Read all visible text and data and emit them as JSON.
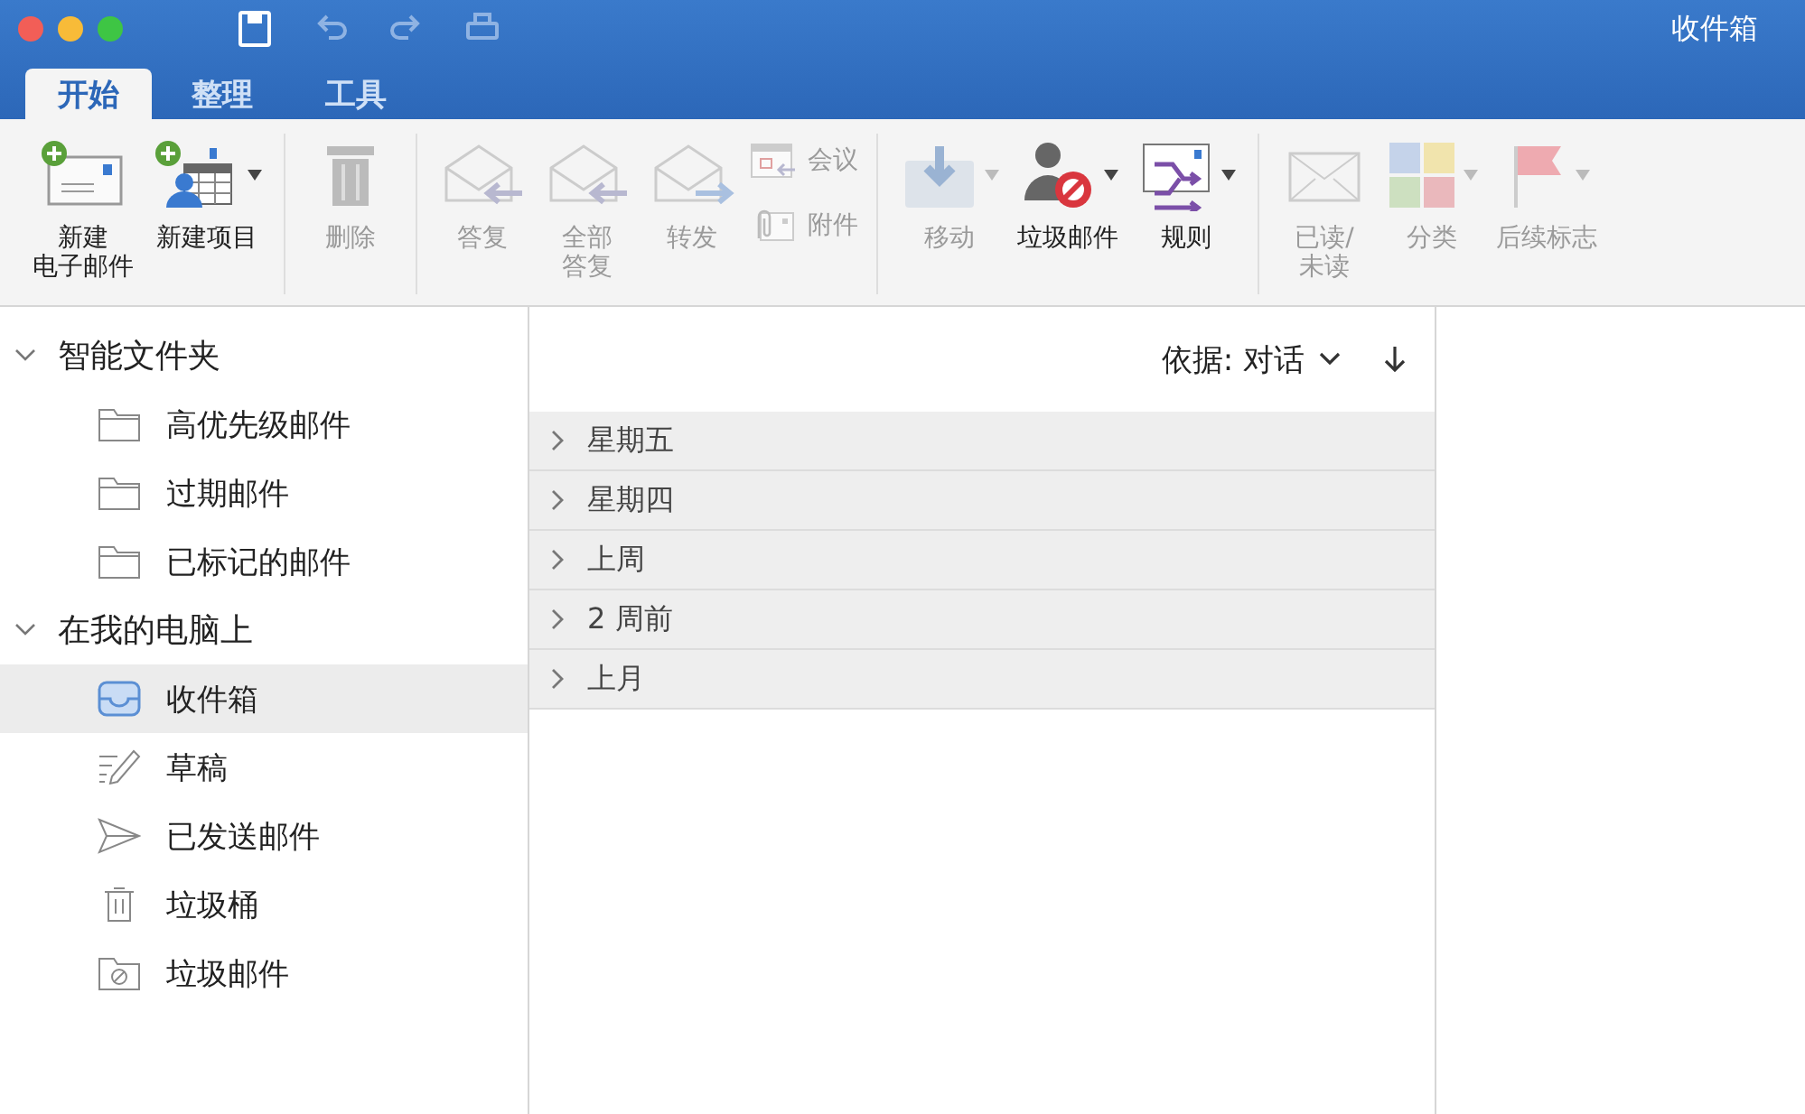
{
  "window": {
    "title": "收件箱"
  },
  "tabs": [
    {
      "label": "开始",
      "selected": true
    },
    {
      "label": "整理",
      "selected": false
    },
    {
      "label": "工具",
      "selected": false
    }
  ],
  "ribbon": [
    {
      "buttons": [
        {
          "kind": "big",
          "label": [
            "新建",
            "电子邮件"
          ],
          "disabled": false,
          "dropdown": false
        },
        {
          "kind": "big",
          "label": "新建项目",
          "disabled": false,
          "dropdown": true
        }
      ]
    },
    {
      "buttons": [
        {
          "kind": "big",
          "label": "删除",
          "disabled": true,
          "dropdown": false
        }
      ]
    },
    {
      "buttons": [
        {
          "kind": "big",
          "label": "答复",
          "disabled": true,
          "dropdown": false
        },
        {
          "kind": "big",
          "label": [
            "全部",
            "答复"
          ],
          "disabled": true,
          "dropdown": false
        },
        {
          "kind": "big",
          "label": "转发",
          "disabled": true,
          "dropdown": false
        },
        {
          "kind": "small",
          "label": "会议",
          "disabled": true
        },
        {
          "kind": "small",
          "label": "附件",
          "disabled": true
        }
      ]
    },
    {
      "buttons": [
        {
          "kind": "big",
          "label": "移动",
          "disabled": true,
          "dropdown": true
        },
        {
          "kind": "big",
          "label": "垃圾邮件",
          "disabled": false,
          "dropdown": true
        },
        {
          "kind": "big",
          "label": "规则",
          "disabled": false,
          "dropdown": true
        }
      ]
    },
    {
      "buttons": [
        {
          "kind": "big",
          "label": [
            "已读/",
            "未读"
          ],
          "disabled": true,
          "dropdown": false
        },
        {
          "kind": "big",
          "label": "分类",
          "disabled": true,
          "dropdown": true
        },
        {
          "kind": "big",
          "label": "后续标志",
          "disabled": true,
          "dropdown": true
        }
      ]
    }
  ],
  "sidebar": {
    "groups": [
      {
        "label": "智能文件夹",
        "expanded": true,
        "children": [
          {
            "label": "高优先级邮件",
            "selected": false
          },
          {
            "label": "过期邮件",
            "selected": false
          },
          {
            "label": "已标记的邮件",
            "selected": false
          }
        ]
      },
      {
        "label": "在我的电脑上",
        "expanded": true,
        "children": [
          {
            "label": "收件箱",
            "selected": true
          },
          {
            "label": "草稿",
            "selected": false
          },
          {
            "label": "已发送邮件",
            "selected": false
          },
          {
            "label": "垃圾桶",
            "selected": false
          },
          {
            "label": "垃圾邮件",
            "selected": false
          }
        ]
      }
    ]
  },
  "message_list": {
    "sort_label": "依据: 对话",
    "groups": [
      {
        "label": "星期五",
        "expanded": false
      },
      {
        "label": "星期四",
        "expanded": false
      },
      {
        "label": "上周",
        "expanded": false
      },
      {
        "label": "2 周前",
        "expanded": false
      },
      {
        "label": "上月",
        "expanded": false
      }
    ]
  }
}
